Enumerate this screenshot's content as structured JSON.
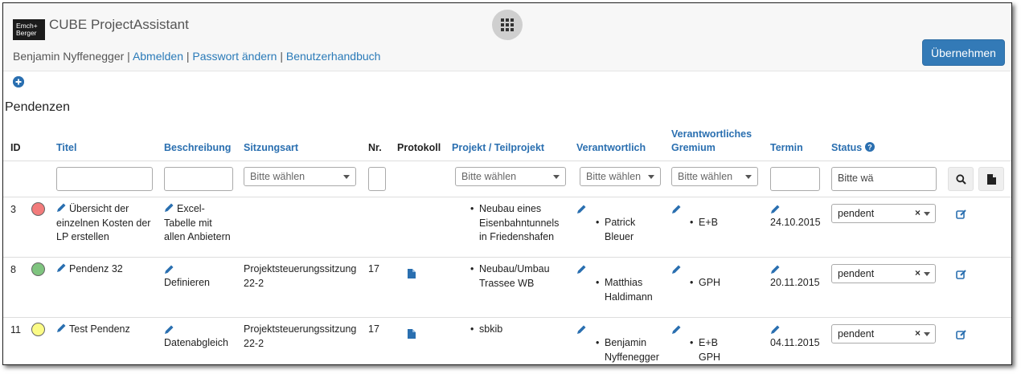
{
  "header": {
    "logo_line1": "Emch+",
    "logo_line2": "Berger",
    "app_title": "CUBE ProjectAssistant",
    "user_name": "Benjamin Nyffenegger",
    "links": [
      "Abmelden",
      "Passwort ändern",
      "Benutzerhandbuch"
    ],
    "apply_label": "Übernehmen"
  },
  "page": {
    "title": "Pendenzen"
  },
  "columns": {
    "id": "ID",
    "titel": "Titel",
    "beschreibung": "Beschreibung",
    "sitzungsart": "Sitzungsart",
    "nr": "Nr.",
    "protokoll": "Protokoll",
    "projekt": "Projekt / Teilprojekt",
    "verantwortlich": "Verantwortlich",
    "gremium_line1": "Verantwortliches",
    "gremium_line2": "Gremium",
    "termin": "Termin",
    "status": "Status"
  },
  "filters": {
    "select_placeholder": "Bitte wählen",
    "status_value": "Bitte wä"
  },
  "colors": {
    "link": "#2a6fb0",
    "primary": "#337ab7",
    "red": "#f27b7b",
    "green": "#7fc47f",
    "yellow": "#fbfb86"
  },
  "rows": [
    {
      "id": "3",
      "status_color": "red",
      "titel": [
        "Übersicht der",
        "einzelnen Kosten der",
        "LP erstellen"
      ],
      "beschreibung": [
        "Excel-",
        "Tabelle mit",
        "allen Anbietern"
      ],
      "sitzungsart": [
        "",
        ""
      ],
      "nr": "",
      "projekt": [
        "Neubau eines",
        "Eisenbahntunnels",
        "in Friedenshafen"
      ],
      "verantwortlich": [
        "Patrick",
        "Bleuer"
      ],
      "gremium": [
        "E+B"
      ],
      "termin": "24.10.2015",
      "status": "pendent"
    },
    {
      "id": "8",
      "status_color": "green",
      "titel": [
        "Pendenz 32"
      ],
      "beschreibung": [
        "Definieren"
      ],
      "sitzungsart": [
        "Projektsteuerungssitzung",
        "22-2"
      ],
      "nr": "17",
      "projekt": [
        "Neubau/Umbau",
        "Trassee WB"
      ],
      "verantwortlich": [
        "Matthias",
        "Haldimann"
      ],
      "gremium": [
        "GPH"
      ],
      "termin": "20.11.2015",
      "status": "pendent"
    },
    {
      "id": "11",
      "status_color": "yellow",
      "titel": [
        "Test Pendenz"
      ],
      "beschreibung": [
        "Datenabgleich"
      ],
      "sitzungsart": [
        "Projektsteuerungssitzung",
        "22-2"
      ],
      "nr": "17",
      "projekt": [
        "sbkib"
      ],
      "verantwortlich": [
        "Benjamin",
        "Nyffenegger"
      ],
      "gremium": [
        "E+B",
        "GPH"
      ],
      "termin": "04.11.2015",
      "status": "pendent"
    }
  ]
}
